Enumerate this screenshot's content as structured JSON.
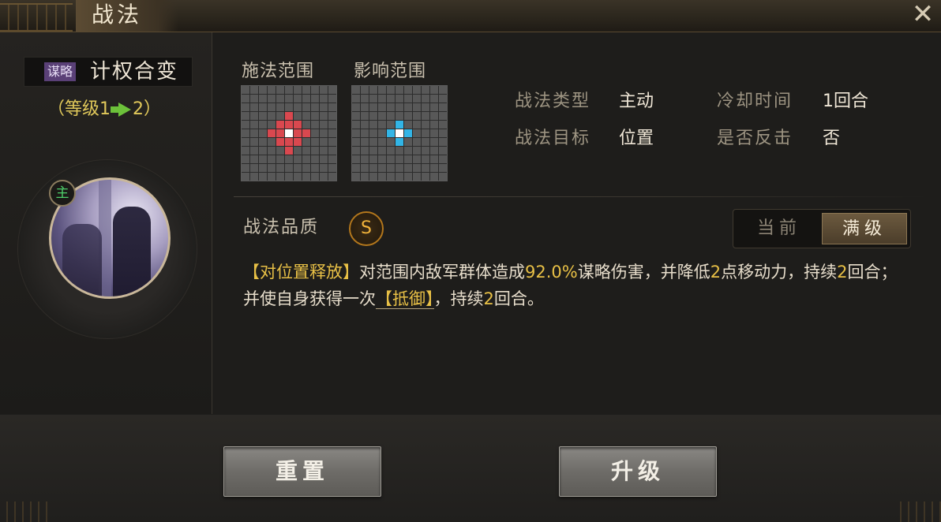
{
  "window": {
    "title": "战法",
    "close_icon": "close-icon"
  },
  "skill": {
    "tag": "谋略",
    "name": "计权合变",
    "level_open": "（等级1",
    "level_close": "2）",
    "main_badge": "主"
  },
  "ranges": {
    "cast_label": "施法范围",
    "effect_label": "影响范围",
    "cast_red_cells": [
      [
        3,
        5
      ],
      [
        4,
        4
      ],
      [
        4,
        5
      ],
      [
        4,
        6
      ],
      [
        5,
        3
      ],
      [
        5,
        4
      ],
      [
        5,
        6
      ],
      [
        5,
        7
      ],
      [
        6,
        4
      ],
      [
        6,
        5
      ],
      [
        6,
        6
      ],
      [
        7,
        5
      ]
    ],
    "cast_white_cells": [
      [
        5,
        5
      ]
    ],
    "effect_blue_cells": [
      [
        4,
        5
      ],
      [
        5,
        4
      ],
      [
        5,
        6
      ],
      [
        6,
        5
      ]
    ],
    "effect_white_cells": [
      [
        5,
        5
      ]
    ],
    "colors": {
      "red": "#d9484f",
      "blue": "#32b5e6",
      "white": "#ffffff",
      "cell": "#585858"
    }
  },
  "info": {
    "type_label": "战法类型",
    "type_value": "主动",
    "cooldown_label": "冷却时间",
    "cooldown_value": "1回合",
    "target_label": "战法目标",
    "target_value": "位置",
    "counter_label": "是否反击",
    "counter_value": "否"
  },
  "quality": {
    "label": "战法品质",
    "grade": "S"
  },
  "toggle": {
    "current": "当前",
    "max": "满级"
  },
  "description": {
    "p1": "【对位置释放】",
    "p2": "对范围内敌军群体造成",
    "p3": "92.0%",
    "p4": "谋略伤害，并降低",
    "p5": "2",
    "p6": "点移动力，持续",
    "p7": "2",
    "p8": "回合；并使自身获得一次",
    "p9": "【抵御】",
    "p10": "，持续",
    "p11": "2",
    "p12": "回合。"
  },
  "buttons": {
    "reset": "重置",
    "upgrade": "升级"
  }
}
